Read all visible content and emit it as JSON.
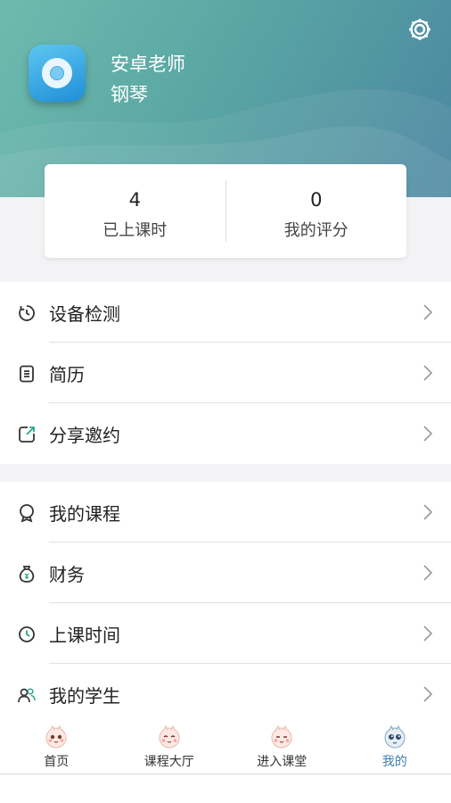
{
  "profile": {
    "name": "安卓老师",
    "subject": "钢琴"
  },
  "stats": [
    {
      "value": "4",
      "label": "已上课时"
    },
    {
      "value": "0",
      "label": "我的评分"
    }
  ],
  "menu_group1": [
    {
      "label": "设备检测",
      "icon": "timer-icon"
    },
    {
      "label": "简历",
      "icon": "document-icon"
    },
    {
      "label": "分享邀约",
      "icon": "share-icon"
    }
  ],
  "menu_group2": [
    {
      "label": "我的课程",
      "icon": "badge-icon"
    },
    {
      "label": "财务",
      "icon": "money-bag-icon"
    },
    {
      "label": "上课时间",
      "icon": "clock-icon"
    },
    {
      "label": "我的学生",
      "icon": "students-icon"
    }
  ],
  "tabs": [
    {
      "label": "首页",
      "icon": "home-face-icon",
      "active": false
    },
    {
      "label": "课程大厅",
      "icon": "course-hall-face-icon",
      "active": false
    },
    {
      "label": "进入课堂",
      "icon": "enter-class-face-icon",
      "active": false
    },
    {
      "label": "我的",
      "icon": "mine-face-icon",
      "active": true
    }
  ],
  "colors": {
    "header_start": "#6dbbae",
    "header_end": "#4a86a0",
    "active_tab": "#3b7fb2"
  }
}
